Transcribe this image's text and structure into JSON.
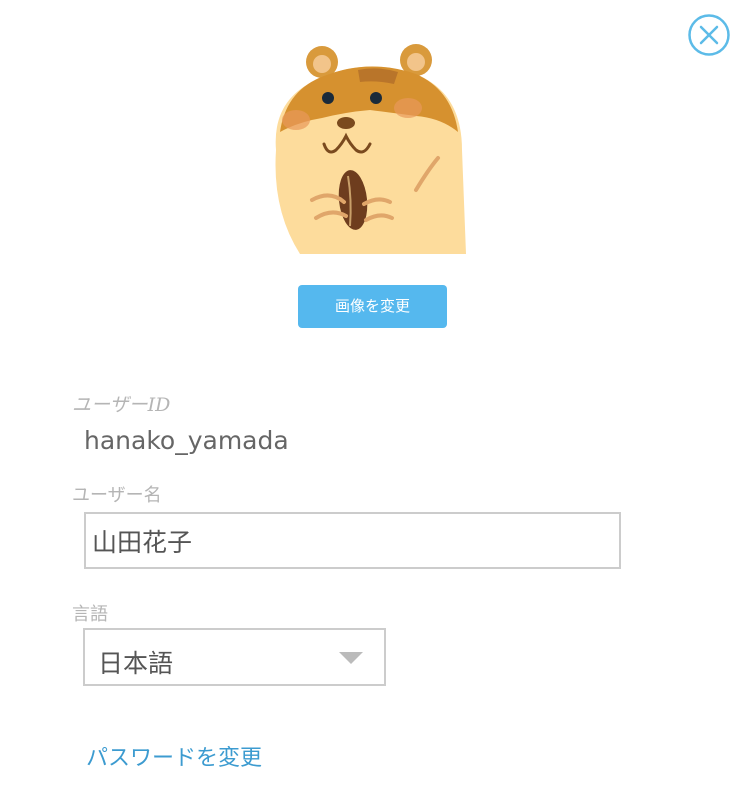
{
  "profile": {
    "avatar_icon": "hamster-avatar",
    "change_image_label": "画像を変更",
    "close_icon": "close-icon",
    "accent_color": "#55b8ee",
    "link_color": "#3c9bd0"
  },
  "fields": {
    "user_id_label": "ユーザーID",
    "user_id_value": "hanako_yamada",
    "user_name_label": "ユーザー名",
    "user_name_value": "山田花子",
    "language_label": "言語",
    "language_value": "日本語"
  },
  "links": {
    "change_password": "パスワードを変更"
  }
}
